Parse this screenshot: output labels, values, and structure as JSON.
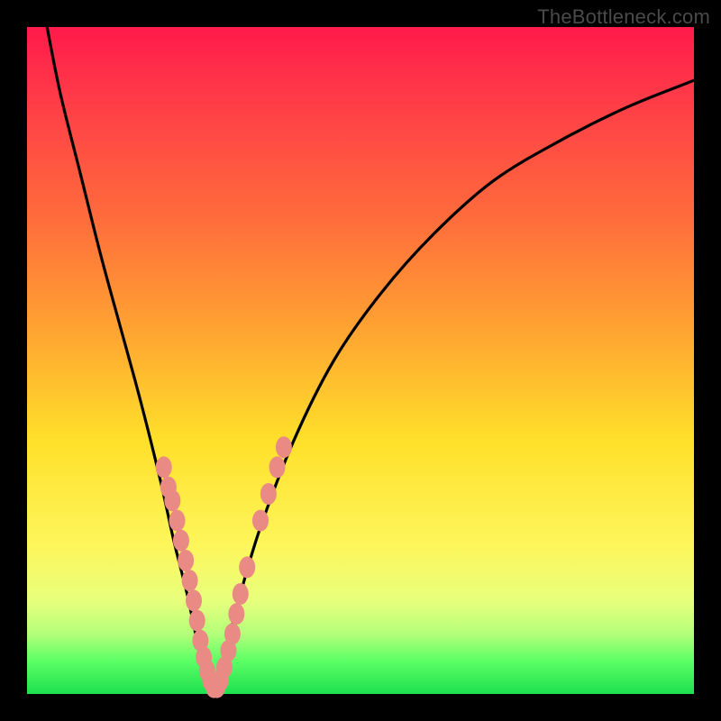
{
  "watermark": "TheBottleneck.com",
  "colors": {
    "curve_stroke": "#000000",
    "dot_fill": "#e98a84",
    "background_black": "#000000"
  },
  "chart_data": {
    "type": "line",
    "title": "",
    "xlabel": "",
    "ylabel": "",
    "xlim": [
      0,
      100
    ],
    "ylim": [
      0,
      100
    ],
    "series": [
      {
        "name": "bottleneck-curve",
        "x": [
          3,
          5,
          8,
          11,
          14,
          17,
          20,
          22,
          24,
          25.5,
          27,
          28,
          29,
          30,
          32,
          35,
          40,
          46,
          53,
          61,
          70,
          80,
          90,
          100
        ],
        "y": [
          100,
          90,
          78,
          66,
          55,
          44,
          32,
          23,
          15,
          8,
          2,
          0,
          2,
          7,
          15,
          25,
          38,
          50,
          60,
          69,
          77,
          83,
          88,
          92
        ]
      }
    ],
    "highlight_points": {
      "name": "left-cluster-and-right-cluster",
      "points": [
        {
          "x": 20.5,
          "y": 34
        },
        {
          "x": 21.2,
          "y": 31
        },
        {
          "x": 21.8,
          "y": 29
        },
        {
          "x": 22.5,
          "y": 26
        },
        {
          "x": 23.1,
          "y": 23
        },
        {
          "x": 23.8,
          "y": 20
        },
        {
          "x": 24.4,
          "y": 17
        },
        {
          "x": 25.0,
          "y": 14
        },
        {
          "x": 25.5,
          "y": 11
        },
        {
          "x": 26.0,
          "y": 8
        },
        {
          "x": 26.5,
          "y": 5.5
        },
        {
          "x": 27.0,
          "y": 3.5
        },
        {
          "x": 27.5,
          "y": 2
        },
        {
          "x": 28.0,
          "y": 1
        },
        {
          "x": 28.5,
          "y": 1
        },
        {
          "x": 29.0,
          "y": 2
        },
        {
          "x": 29.6,
          "y": 4
        },
        {
          "x": 30.2,
          "y": 6.5
        },
        {
          "x": 30.8,
          "y": 9
        },
        {
          "x": 31.4,
          "y": 12
        },
        {
          "x": 32.0,
          "y": 15
        },
        {
          "x": 33.0,
          "y": 19
        },
        {
          "x": 35.0,
          "y": 26
        },
        {
          "x": 36.2,
          "y": 30
        },
        {
          "x": 37.5,
          "y": 34
        },
        {
          "x": 38.5,
          "y": 37
        }
      ]
    }
  }
}
